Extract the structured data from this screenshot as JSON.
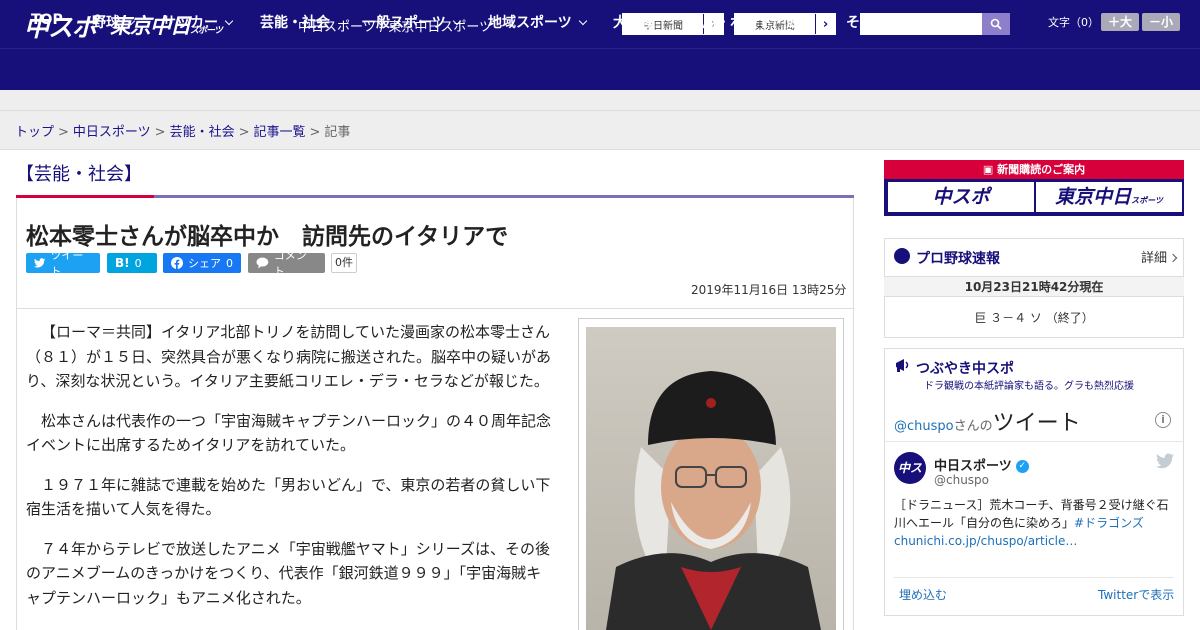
{
  "header": {
    "logo_chuspo": "中スポ",
    "logo_tokyo": "東京中日",
    "logo_tokyo_small": "スポーツ",
    "site_name": "中日スポーツ / 東京中日スポーツ",
    "ext_links": [
      "中日新聞",
      "東京新聞"
    ],
    "font_size_label": "文字（0）",
    "font_plus": "＋大",
    "font_minus": "－小",
    "search_placeholder": ""
  },
  "nav": {
    "items": [
      {
        "label": "TOP"
      },
      {
        "label": "野球"
      },
      {
        "label": "サッカー"
      },
      {
        "label": "芸能・社会"
      },
      {
        "label": "一般スポーツ"
      },
      {
        "label": "地域スポーツ"
      },
      {
        "label": "大相撲"
      },
      {
        "label": "競馬・ボート・競輪"
      },
      {
        "label": "その他"
      }
    ]
  },
  "breadcrumb": {
    "items": [
      "トップ",
      "中日スポーツ",
      "芸能・社会",
      "記事一覧"
    ],
    "current": "記事",
    "separator": ">"
  },
  "section": {
    "title": "【芸能・社会】"
  },
  "article": {
    "headline": "松本零士さんが脳卒中か　訪問先のイタリアで",
    "share": {
      "tweet": "ツイート",
      "hatena_label": "B!",
      "hatena_count": "0",
      "facebook": "シェア",
      "facebook_count": "0",
      "comment": "コメント",
      "comment_count": "0件"
    },
    "date": "2019年11月16日 13時25分",
    "paragraphs": [
      "【ローマ＝共同】イタリア北部トリノを訪問していた漫画家の松本零士さん（８１）が１５日、突然具合が悪くなり病院に搬送された。脳卒中の疑いがあり、深刻な状況という。イタリア主要紙コリエレ・デラ・セラなどが報じた。",
      "松本さんは代表作の一つ「宇宙海賊キャプテンハーロック」の４０周年記念イベントに出席するためイタリアを訪れていた。",
      "１９７１年に雑誌で連載を始めた「男おいどん」で、東京の若者の貧しい下宿生活を描いて人気を得た。",
      "７４年からテレビで放送したアニメ「宇宙戦艦ヤマト」シリーズは、その後のアニメブームのきっかけをつくり、代表作「銀河鉄道９９９」「宇宙海賊キャプテンハーロック」もアニメ化された。"
    ]
  },
  "sidebar": {
    "subscribe": {
      "heading": "新聞購読のご案内",
      "logo_chuspo": "中スポ",
      "logo_tokyo": "東京中日",
      "logo_tokyo_small": "スポーツ"
    },
    "baseball": {
      "title": "プロ野球速報",
      "detail": "詳細",
      "time": "10月23日21時42分現在",
      "score": "巨 ３－４ ソ （終了）"
    },
    "twitter": {
      "title": "つぶやき中スポ",
      "subtitle": "ドラ観戦の本紙評論家も語る。グラも熱烈応援",
      "handle": "@chuspo",
      "handle_suffix": "さんの",
      "tweet_word": "ツイート",
      "account_name": "中日スポーツ",
      "account_at": "@chuspo",
      "avatar_text": "中スポ",
      "tweet_text": "［ドラニュース］荒木コーチ、背番号２受け継ぐ石川へエール「自分の色に染めろ」",
      "tweet_hashtag": "#ドラゴンズ",
      "tweet_link": "chunichi.co.jp/chuspo/article…",
      "embed": "埋め込む",
      "view": "Twitterで表示"
    }
  },
  "colors": {
    "brand_navy": "#17107a",
    "accent_red": "#d7003a",
    "twitter_blue": "#1da1f2",
    "facebook_blue": "#1877f2",
    "hatena_blue": "#00a4de"
  }
}
